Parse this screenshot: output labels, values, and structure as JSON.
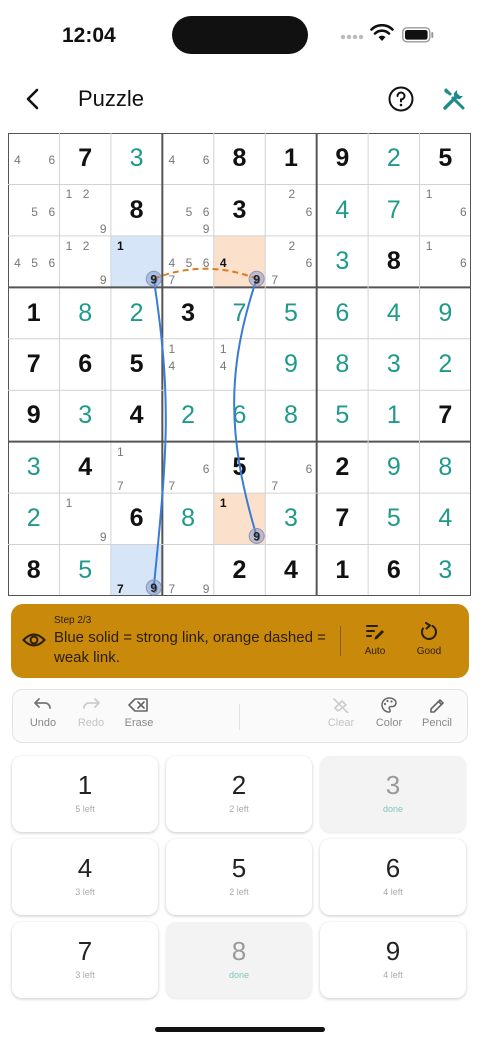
{
  "status": {
    "time": "12:04"
  },
  "header": {
    "title": "Puzzle",
    "back_icon": "chevron-left-icon",
    "help_icon": "help-icon",
    "tools_icon": "tools-icon"
  },
  "grid": {
    "cells": [
      [
        {
          "n": "46"
        },
        {
          "v": "7",
          "g": true
        },
        {
          "v": "3"
        },
        {
          "n": "46"
        },
        {
          "v": "8",
          "g": true
        },
        {
          "v": "1",
          "g": true
        },
        {
          "v": "9",
          "g": true
        },
        {
          "v": "2"
        },
        {
          "v": "5",
          "g": true
        }
      ],
      [
        {
          "n": "56"
        },
        {
          "n": "129"
        },
        {
          "v": "8",
          "g": true
        },
        {
          "n": "569"
        },
        {
          "v": "3",
          "g": true
        },
        {
          "n": "26"
        },
        {
          "v": "4"
        },
        {
          "v": "7"
        },
        {
          "n": "16"
        }
      ],
      [
        {
          "n": "456"
        },
        {
          "n": "129"
        },
        {
          "n": "19",
          "bg": "blue"
        },
        {
          "n": "4567"
        },
        {
          "n": "49",
          "bg": "orange"
        },
        {
          "n": "267"
        },
        {
          "v": "3"
        },
        {
          "v": "8",
          "g": true
        },
        {
          "n": "16"
        }
      ],
      [
        {
          "v": "1",
          "g": true
        },
        {
          "v": "8"
        },
        {
          "v": "2"
        },
        {
          "v": "3",
          "g": true
        },
        {
          "v": "7"
        },
        {
          "v": "5"
        },
        {
          "v": "6"
        },
        {
          "v": "4"
        },
        {
          "v": "9"
        }
      ],
      [
        {
          "v": "7",
          "g": true
        },
        {
          "v": "6",
          "g": true
        },
        {
          "v": "5",
          "g": true
        },
        {
          "n": "14"
        },
        {
          "n": "14"
        },
        {
          "v": "9"
        },
        {
          "v": "8"
        },
        {
          "v": "3"
        },
        {
          "v": "2"
        }
      ],
      [
        {
          "v": "9",
          "g": true
        },
        {
          "v": "3"
        },
        {
          "v": "4",
          "g": true
        },
        {
          "v": "2"
        },
        {
          "v": "6"
        },
        {
          "v": "8"
        },
        {
          "v": "5"
        },
        {
          "v": "1"
        },
        {
          "v": "7",
          "g": true
        }
      ],
      [
        {
          "v": "3"
        },
        {
          "v": "4",
          "g": true
        },
        {
          "n": "17"
        },
        {
          "n": "67"
        },
        {
          "v": "5",
          "g": true
        },
        {
          "n": "67"
        },
        {
          "v": "2",
          "g": true
        },
        {
          "v": "9"
        },
        {
          "v": "8"
        }
      ],
      [
        {
          "v": "2"
        },
        {
          "n": "19"
        },
        {
          "v": "6",
          "g": true
        },
        {
          "v": "8"
        },
        {
          "n": "19",
          "bg": "orange"
        },
        {
          "v": "3"
        },
        {
          "v": "7",
          "g": true
        },
        {
          "v": "5"
        },
        {
          "v": "4"
        }
      ],
      [
        {
          "v": "8",
          "g": true
        },
        {
          "v": "5"
        },
        {
          "n": "79",
          "bg": "blue"
        },
        {
          "n": "79"
        },
        {
          "v": "2",
          "g": true
        },
        {
          "v": "4",
          "g": true
        },
        {
          "v": "1",
          "g": true
        },
        {
          "v": "6",
          "g": true
        },
        {
          "v": "3"
        }
      ]
    ],
    "highlight_colors": {
      "blue": "#d6e6f8",
      "orange": "#fbe0cc"
    },
    "strong_link_color": "#3a7bd5",
    "weak_link_color": "#e07a1f"
  },
  "hint": {
    "step": "Step 2/3",
    "text": "Blue solid = strong link, orange dashed = weak link.",
    "auto_label": "Auto",
    "good_label": "Good",
    "color": "#c98a0c"
  },
  "toolbar": {
    "undo": "Undo",
    "redo": "Redo",
    "erase": "Erase",
    "clear": "Clear",
    "color": "Color",
    "pencil": "Pencil"
  },
  "keypad": [
    {
      "num": "1",
      "sub": "5 left",
      "done": false
    },
    {
      "num": "2",
      "sub": "2 left",
      "done": false
    },
    {
      "num": "3",
      "sub": "done",
      "done": true
    },
    {
      "num": "4",
      "sub": "3 left",
      "done": false
    },
    {
      "num": "5",
      "sub": "2 left",
      "done": false
    },
    {
      "num": "6",
      "sub": "4 left",
      "done": false
    },
    {
      "num": "7",
      "sub": "3 left",
      "done": false
    },
    {
      "num": "8",
      "sub": "done",
      "done": true
    },
    {
      "num": "9",
      "sub": "4 left",
      "done": false
    }
  ]
}
